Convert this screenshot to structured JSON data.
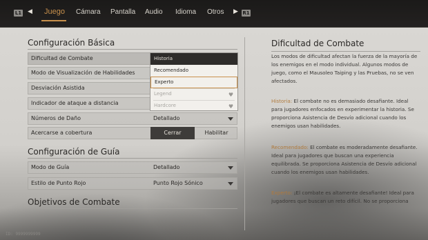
{
  "nav": {
    "left_key": "L1",
    "right_key": "R1",
    "left_arrow": "◀",
    "right_arrow": "▶",
    "tabs": [
      "Juego",
      "Cámara",
      "Pantalla",
      "Audio",
      "Idioma",
      "Otros"
    ],
    "active_tab": "Juego",
    "accent_color": "#c8904c"
  },
  "basic": {
    "title": "Configuración Básica",
    "rows": [
      {
        "label": "Dificultad de Combate",
        "value": ""
      },
      {
        "label": "Modo de Visualización de Habilidades",
        "value": ""
      },
      {
        "label": "Desviación Asistida",
        "value": ""
      },
      {
        "label": "Indicador de ataque a distancia",
        "value": ""
      },
      {
        "label": "Números de Daño",
        "value": "Detallado"
      },
      {
        "label": "Acercarse a cobertura",
        "value": ""
      }
    ],
    "toggle": {
      "on": "Cerrar",
      "off": "Habilitar"
    }
  },
  "dropdown": {
    "options": [
      "Historia",
      "Recomendado",
      "Experto",
      "Legend",
      "Hardcore"
    ],
    "current": "Historia",
    "selected": "Experto",
    "locked_icon": "heart-icon"
  },
  "guide": {
    "title": "Configuración de Guía",
    "rows": [
      {
        "label": "Modo de Guía",
        "value": "Detallado"
      },
      {
        "label": "Estilo de Punto Rojo",
        "value": "Punto Rojo Sónico"
      }
    ]
  },
  "objectives": {
    "title": "Objetivos de Combate"
  },
  "info": {
    "title": "Dificultad de Combate",
    "intro": "Los modos de dificultad afectan la fuerza de la mayoría de los enemigos en el modo individual. Algunos modos de juego, como el Mausoleo Taiping y las Pruebas, no se ven afectados.",
    "items": [
      {
        "key": "Historia:",
        "text": " El combate no es demasiado desafiante. Ideal para jugadores enfocados en experimentar la historia. Se proporciona Asistencia de Desvío adicional cuando los enemigos usan habilidades."
      },
      {
        "key": "Recomendado:",
        "text": " El combate es moderadamente desafiante. Ideal para jugadores que buscan una experiencia equilibrada. Se proporciona Asistencia de Desvío adicional cuando los enemigos usan habilidades."
      },
      {
        "key": "Experto:",
        "text": " ¡El combate es altamente desafiante! Ideal para jugadores que buscan un reto difícil. No se proporciona"
      }
    ]
  },
  "footer": {
    "id": "ID: 9999999999"
  }
}
